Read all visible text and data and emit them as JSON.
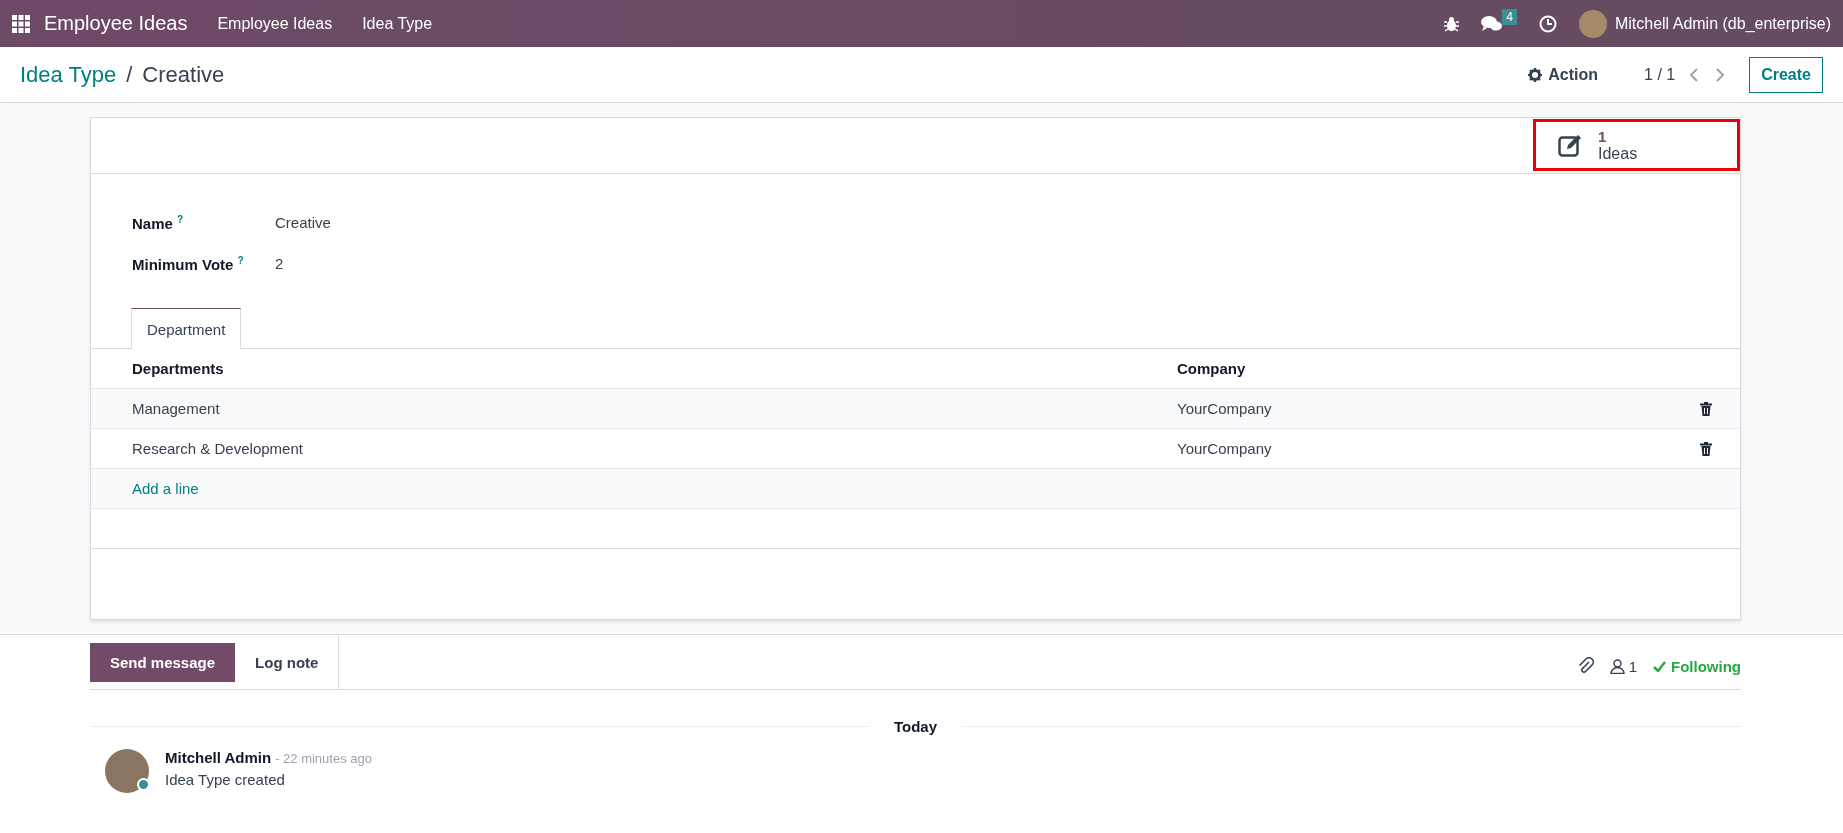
{
  "navbar": {
    "app_name": "Employee Ideas",
    "menu": [
      "Employee Ideas",
      "Idea Type"
    ],
    "messages_badge": "4",
    "user": "Mitchell Admin (db_enterprise)"
  },
  "breadcrumb": [
    {
      "label": "Idea Type"
    },
    {
      "label": "Creative"
    }
  ],
  "breadcrumb_separator": "/",
  "control_panel": {
    "action": "Action",
    "pager": "1 / 1",
    "create": "Create"
  },
  "stat_button": {
    "value": "1",
    "label": "Ideas",
    "highlighted": true
  },
  "fields": [
    {
      "label": "Name $^{?}$",
      "value": "Creative"
    },
    {
      "label": "Minimum Vote $^{?}$",
      "value": "2"
    }
  ],
  "tabs": [
    {
      "label": "Department",
      "selected": true
    }
  ],
  "table": {
    "columns": [
      "Departments",
      "Company"
    ],
    "rows": [
      {
        "cells": [
          "Management",
          "YourCompany"
        ]
      },
      {
        "cells": [
          "Research & Development",
          "YourCompany"
        ]
      }
    ],
    "add_line": "Add a line"
  },
  "chatter": {
    "buttons": [
      {
        "label": "Send message",
        "selected": true
      },
      {
        "label": "Log note",
        "selected": false
      }
    ],
    "followers": "1",
    "following": "Following",
    "date": "Today",
    "messages": [
      {
        "author": "Mitchell Admin",
        "time": "- 22 minutes ago",
        "body": "Idea Type created"
      }
    ]
  }
}
